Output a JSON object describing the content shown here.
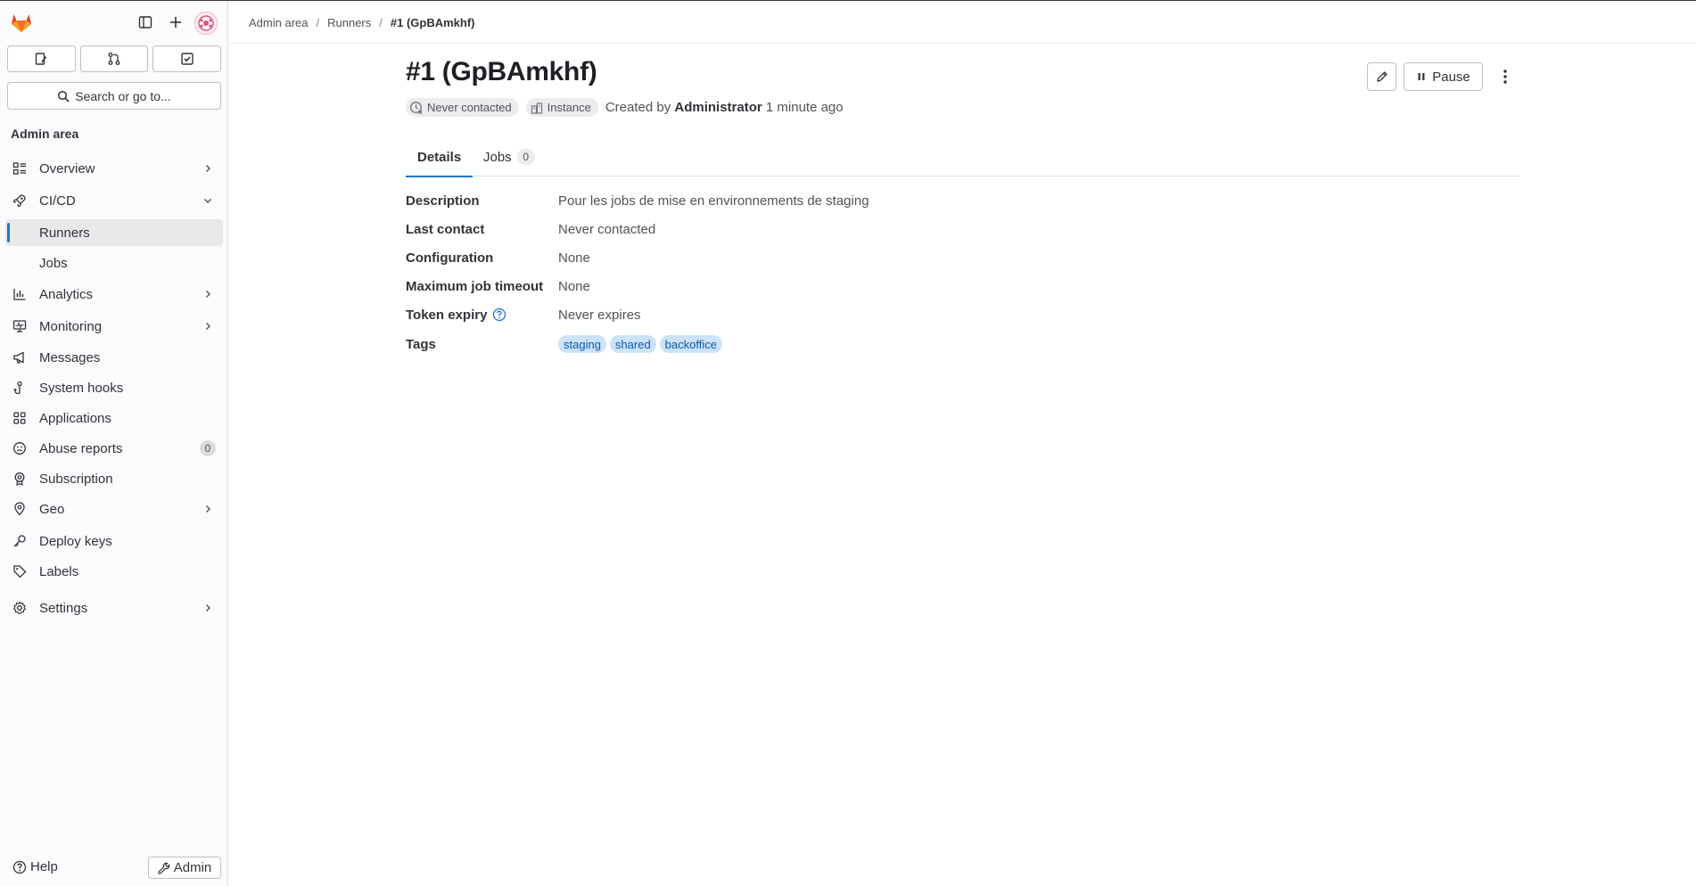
{
  "window": {
    "title": "#1 (GpBAmkhf)"
  },
  "sidebar": {
    "section_title": "Admin area",
    "search_label": "Search or go to...",
    "quick_actions": [
      {
        "name": "issues"
      },
      {
        "name": "merge-requests"
      },
      {
        "name": "todos"
      }
    ],
    "items": [
      {
        "label": "Overview",
        "icon": "overview-icon",
        "chevron": "right"
      },
      {
        "label": "CI/CD",
        "icon": "rocket-icon",
        "chevron": "down"
      },
      {
        "label": "Runners",
        "active": true
      },
      {
        "label": "Jobs"
      },
      {
        "label": "Analytics",
        "icon": "chart-icon",
        "chevron": "right"
      },
      {
        "label": "Monitoring",
        "icon": "monitor-icon",
        "chevron": "right"
      },
      {
        "label": "Messages",
        "icon": "bullhorn-icon"
      },
      {
        "label": "System hooks",
        "icon": "hook-icon"
      },
      {
        "label": "Applications",
        "icon": "applications-icon"
      },
      {
        "label": "Abuse reports",
        "icon": "abuse-icon",
        "badge": "0"
      },
      {
        "label": "Subscription",
        "icon": "subscription-icon"
      },
      {
        "label": "Geo",
        "icon": "geo-icon",
        "chevron": "right"
      },
      {
        "label": "Deploy keys",
        "icon": "key-icon"
      },
      {
        "label": "Labels",
        "icon": "label-icon"
      },
      {
        "label": "Settings",
        "icon": "gear-icon",
        "chevron": "right"
      }
    ],
    "help_label": "Help",
    "admin_label": "Admin"
  },
  "breadcrumb": [
    "Admin area",
    "Runners",
    "#1 (GpBAmkhf)"
  ],
  "header": {
    "title": "#1 (GpBAmkhf)",
    "status_pill": "Never contacted",
    "type_pill": "Instance",
    "created_prefix": "Created by",
    "created_by": "Administrator",
    "created_when": "1 minute ago",
    "pause_label": "Pause"
  },
  "tabs": [
    {
      "label": "Details",
      "active": true
    },
    {
      "label": "Jobs",
      "count": "0"
    }
  ],
  "details": {
    "description": {
      "label": "Description",
      "value": "Pour les jobs de mise en environnements de staging"
    },
    "last_contact": {
      "label": "Last contact",
      "value": "Never contacted"
    },
    "configuration": {
      "label": "Configuration",
      "value": "None"
    },
    "max_timeout": {
      "label": "Maximum job timeout",
      "value": "None"
    },
    "token_expiry": {
      "label": "Token expiry",
      "value": "Never expires"
    },
    "tags": {
      "label": "Tags",
      "values": [
        "staging",
        "shared",
        "backoffice"
      ]
    }
  },
  "colors": {
    "accent": "#1f75cb",
    "tag_bg": "#cbe2f9",
    "tag_fg": "#0b5cad",
    "logo": "#e24329"
  }
}
